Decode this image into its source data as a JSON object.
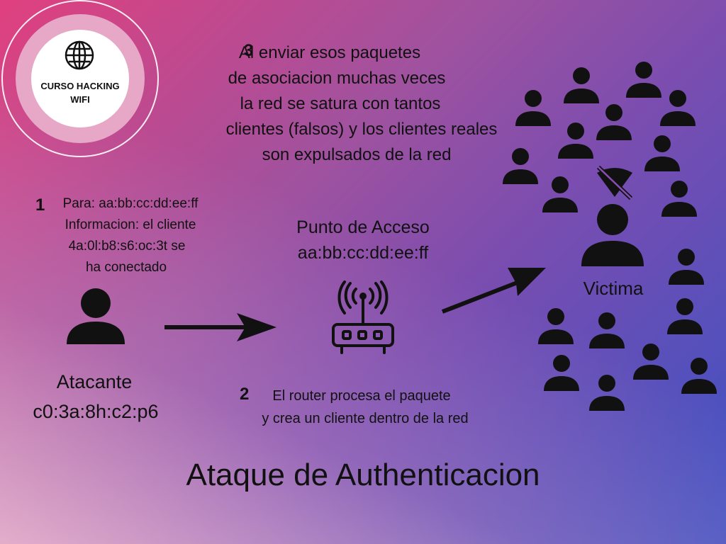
{
  "logo": {
    "line1": "CURSO HACKING",
    "line2": "WIFI",
    "icon": "globe-icon"
  },
  "step3": {
    "number": "3",
    "lines": [
      "Al enviar esos paquetes",
      "de asociacion muchas veces",
      "la red se satura con tantos",
      "clientes (falsos) y los clientes reales",
      "son expulsados de la red"
    ]
  },
  "step1": {
    "number": "1",
    "lines": [
      "Para: aa:bb:cc:dd:ee:ff",
      "Informacion: el cliente",
      "4a:0l:b8:s6:oc:3t se",
      "ha conectado"
    ]
  },
  "access_point": {
    "label": "Punto de Acceso",
    "mac": "aa:bb:cc:dd:ee:ff",
    "icon": "router-icon"
  },
  "attacker": {
    "label": "Atacante",
    "mac": "c0:3a:8h:c2:p6",
    "icon": "person-icon"
  },
  "step2": {
    "number": "2",
    "lines": [
      "El router procesa el paquete",
      "y crea un cliente dentro de la red"
    ]
  },
  "victim": {
    "label": "Victima",
    "icon": "no-wifi-icon"
  },
  "title": "Ataque de Authenticacion",
  "colors": {
    "gradient_start": "#e0407e",
    "gradient_end": "#3b52c4",
    "text": "#111111"
  }
}
